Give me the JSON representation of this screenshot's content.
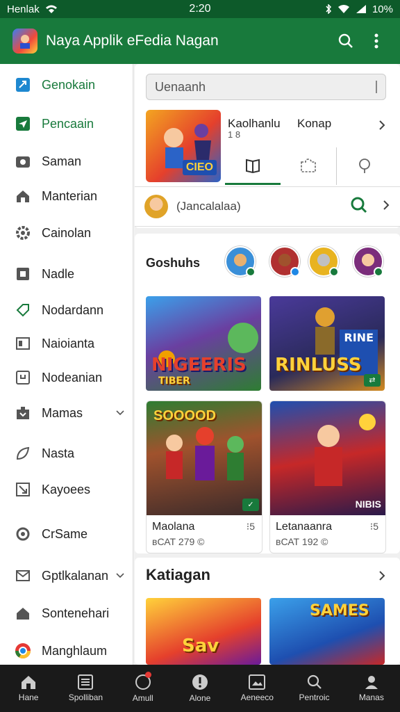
{
  "status": {
    "carrier": "Henlak",
    "time": "2:20",
    "battery": "10%"
  },
  "appbar": {
    "title": "Naya Applik eFedia Nagan",
    "search_icon": "search-icon",
    "more_icon": "more-vert-icon"
  },
  "drawer": {
    "items": [
      {
        "label": "Genokain",
        "icon": "shortcut-icon",
        "active": true
      },
      {
        "label": "Pencaain",
        "icon": "send-icon",
        "active": true
      },
      {
        "label": "Saman",
        "icon": "camera-icon"
      },
      {
        "label": "Manterian",
        "icon": "home-icon"
      },
      {
        "label": "Cainolan",
        "icon": "gear-icon"
      },
      {
        "label": "Nadle",
        "icon": "contact-icon"
      },
      {
        "label": "Nodardann",
        "icon": "tag-icon"
      },
      {
        "label": "Naioianta",
        "icon": "gallery-icon"
      },
      {
        "label": "Nodeanian",
        "icon": "frame-icon"
      },
      {
        "label": "Mamas",
        "icon": "briefcase-icon",
        "has_chevron": true
      },
      {
        "label": "Nasta",
        "icon": "leaf-icon"
      },
      {
        "label": "Kayoees",
        "icon": "arrow-box-icon"
      },
      {
        "label": "CrSame",
        "icon": "circle-icon"
      },
      {
        "label": "Gptlkalanan",
        "icon": "mail-icon",
        "has_chevron": true
      },
      {
        "label": "Sontenehari",
        "icon": "house-icon"
      },
      {
        "label": "Manghlaum",
        "icon": "chrome-icon"
      }
    ]
  },
  "main": {
    "search_placeholder": "Uenaanh",
    "featured": {
      "title": "Kaolhanlu",
      "sub": "1 8",
      "title2": "Konap"
    },
    "profile_row": {
      "text": "(Jancalalaa)"
    },
    "games_title": "Goshuhs",
    "tiles": [
      {
        "label": "NIGEERIS",
        "sub": "TIBER"
      },
      {
        "label": "RINLUSS",
        "sub": "RINE"
      }
    ],
    "cards": [
      {
        "name": "Maolana",
        "meta": "вСАТ 279 ©",
        "dl": "⁝5",
        "art_label": "SOOOOD"
      },
      {
        "name": "Letanaanra",
        "meta": "вСАТ 192 ©",
        "dl": "⁝5",
        "art_label": "NIBIS"
      }
    ],
    "kategori": "Katiagan",
    "bottom_tiles": [
      {
        "label": "Sav"
      },
      {
        "label": "SAMES"
      }
    ]
  },
  "bottom_nav": [
    {
      "label": "Hane",
      "icon": "home-icon"
    },
    {
      "label": "Spolliban",
      "icon": "list-icon"
    },
    {
      "label": "Amull",
      "icon": "circle-icon",
      "dot": true
    },
    {
      "label": "Alone",
      "icon": "alert-icon"
    },
    {
      "label": "Aeneeco",
      "icon": "image-icon"
    },
    {
      "label": "Pentroic",
      "icon": "search-icon"
    },
    {
      "label": "Manas",
      "icon": "person-icon"
    }
  ],
  "colors": {
    "primary": "#187a3c",
    "primary_dark": "#0d5a2a",
    "nav": "#1a1a1a"
  }
}
